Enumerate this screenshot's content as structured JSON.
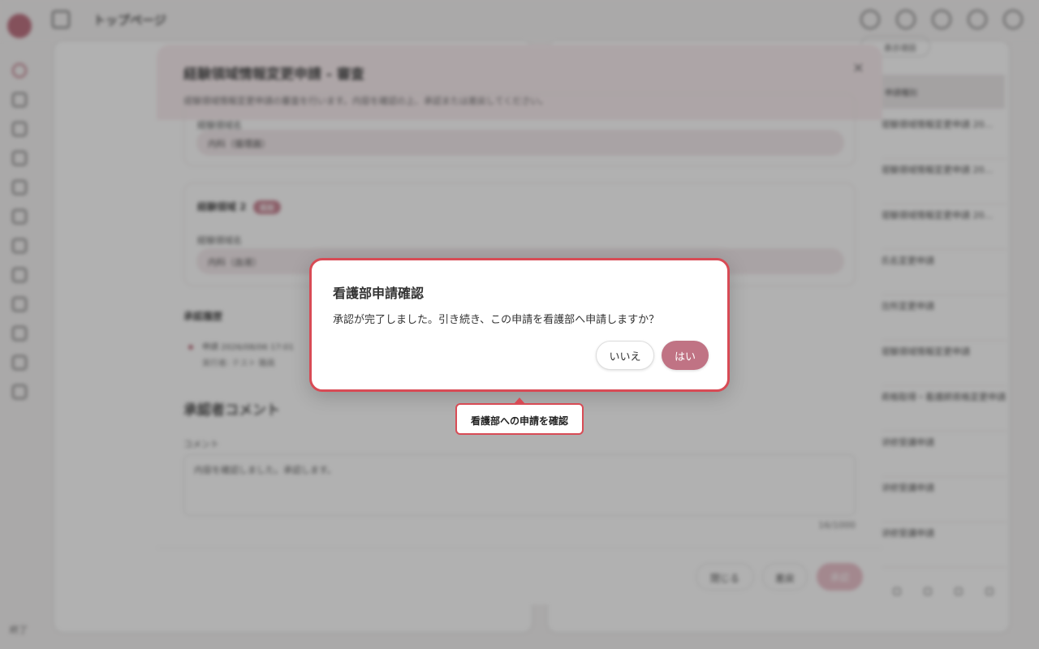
{
  "app": {
    "page_title": "トップページ",
    "sidebar_footer": "終了"
  },
  "right_panel": {
    "filter_chip": "表示項目",
    "table_header": "申請種別",
    "rows": [
      "経験領域情報変更申請 20...",
      "経験領域情報変更申請 20...",
      "経験領域情報変更申請 20...",
      "氏名変更申請",
      "住所変更申請",
      "経験領域情報変更申請",
      "資格取得・看護師資格変更申請",
      "研修受講申請",
      "研修受講申請",
      "研修受講申請"
    ]
  },
  "review_modal": {
    "title": "経験領域情報変更申請 - 審査",
    "description": "経験領域情報変更申請の審査を行います。内容を確認の上、承認または差戻してください。",
    "close_symbol": "×",
    "field1_label": "経験領域名",
    "field1_value": "内科（循環器）",
    "section2_title": "経験領域 2",
    "section2_tag": "追加",
    "field2_label": "経験領域名",
    "field2_value": "内科（血液）",
    "history_title": "承認履歴",
    "history_item": "申請  2026/08/06 17:01",
    "history_sub": "実行者: テスト 職員",
    "comment_heading": "承認者コメント",
    "comment_label": "コメント",
    "comment_value": "内容を確認しました。承認します。",
    "char_count": "16/1000",
    "close_button": "閉じる",
    "reject_button": "差戻",
    "approve_button": "承認"
  },
  "confirm_dialog": {
    "title": "看護部申請確認",
    "message": "承認が完了しました。引き続き、この申請を看護部へ申請しますか？",
    "no_button": "いいえ",
    "yes_button": "はい"
  },
  "callout": {
    "label": "看護部への申請を確認"
  },
  "colors": {
    "accent": "#c07384",
    "highlight_border": "#d84b55",
    "overlay": "#464646"
  }
}
